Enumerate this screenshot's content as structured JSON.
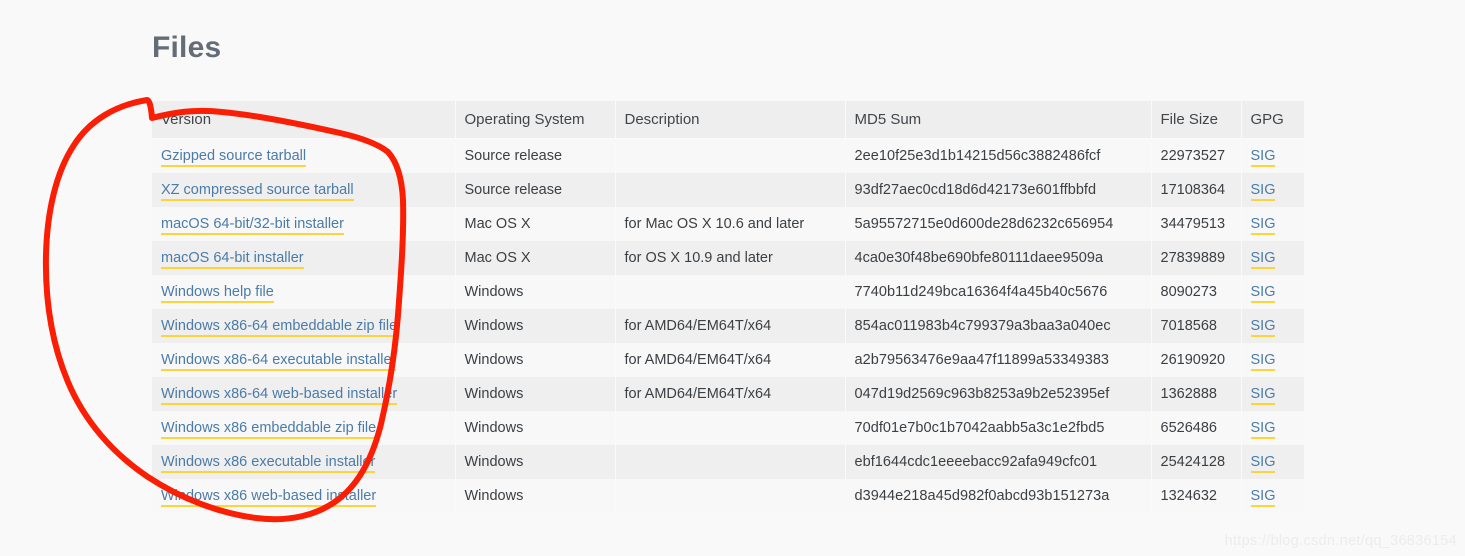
{
  "page": {
    "title": "Files",
    "background_color": "#f9f9f9",
    "heading_color": "#646d76",
    "watermark": "https://blog.csdn.net/qq_36836154"
  },
  "annotation": {
    "type": "freehand-circle",
    "color": "#fa1e05",
    "stroke_width": 6,
    "description": "hand-drawn red oval encircling the Version column"
  },
  "table": {
    "columns": [
      {
        "key": "version",
        "label": "Version"
      },
      {
        "key": "os",
        "label": "Operating System"
      },
      {
        "key": "description",
        "label": "Description"
      },
      {
        "key": "md5",
        "label": "MD5 Sum"
      },
      {
        "key": "filesize",
        "label": "File Size"
      },
      {
        "key": "gpg",
        "label": "GPG"
      }
    ],
    "link_color": "#4b7ba8",
    "link_underline_color": "#ffd43b",
    "header_bg": "#eeeeee",
    "row_bg_odd": "#f8f8f8",
    "row_bg_even": "#efefef",
    "rows": [
      {
        "version": "Gzipped source tarball",
        "os": "Source release",
        "description": "",
        "md5": "2ee10f25e3d1b14215d56c3882486fcf",
        "filesize": "22973527",
        "gpg": "SIG"
      },
      {
        "version": "XZ compressed source tarball",
        "os": "Source release",
        "description": "",
        "md5": "93df27aec0cd18d6d42173e601ffbbfd",
        "filesize": "17108364",
        "gpg": "SIG"
      },
      {
        "version": "macOS 64-bit/32-bit installer",
        "os": "Mac OS X",
        "description": "for Mac OS X 10.6 and later",
        "md5": "5a95572715e0d600de28d6232c656954",
        "filesize": "34479513",
        "gpg": "SIG"
      },
      {
        "version": "macOS 64-bit installer",
        "os": "Mac OS X",
        "description": "for OS X 10.9 and later",
        "md5": "4ca0e30f48be690bfe80111daee9509a",
        "filesize": "27839889",
        "gpg": "SIG"
      },
      {
        "version": "Windows help file",
        "os": "Windows",
        "description": "",
        "md5": "7740b11d249bca16364f4a45b40c5676",
        "filesize": "8090273",
        "gpg": "SIG"
      },
      {
        "version": "Windows x86-64 embeddable zip file",
        "os": "Windows",
        "description": "for AMD64/EM64T/x64",
        "md5": "854ac011983b4c799379a3baa3a040ec",
        "filesize": "7018568",
        "gpg": "SIG"
      },
      {
        "version": "Windows x86-64 executable installer",
        "os": "Windows",
        "description": "for AMD64/EM64T/x64",
        "md5": "a2b79563476e9aa47f11899a53349383",
        "filesize": "26190920",
        "gpg": "SIG"
      },
      {
        "version": "Windows x86-64 web-based installer",
        "os": "Windows",
        "description": "for AMD64/EM64T/x64",
        "md5": "047d19d2569c963b8253a9b2e52395ef",
        "filesize": "1362888",
        "gpg": "SIG"
      },
      {
        "version": "Windows x86 embeddable zip file",
        "os": "Windows",
        "description": "",
        "md5": "70df01e7b0c1b7042aabb5a3c1e2fbd5",
        "filesize": "6526486",
        "gpg": "SIG"
      },
      {
        "version": "Windows x86 executable installer",
        "os": "Windows",
        "description": "",
        "md5": "ebf1644cdc1eeeebacc92afa949cfc01",
        "filesize": "25424128",
        "gpg": "SIG"
      },
      {
        "version": "Windows x86 web-based installer",
        "os": "Windows",
        "description": "",
        "md5": "d3944e218a45d982f0abcd93b151273a",
        "filesize": "1324632",
        "gpg": "SIG"
      }
    ]
  }
}
